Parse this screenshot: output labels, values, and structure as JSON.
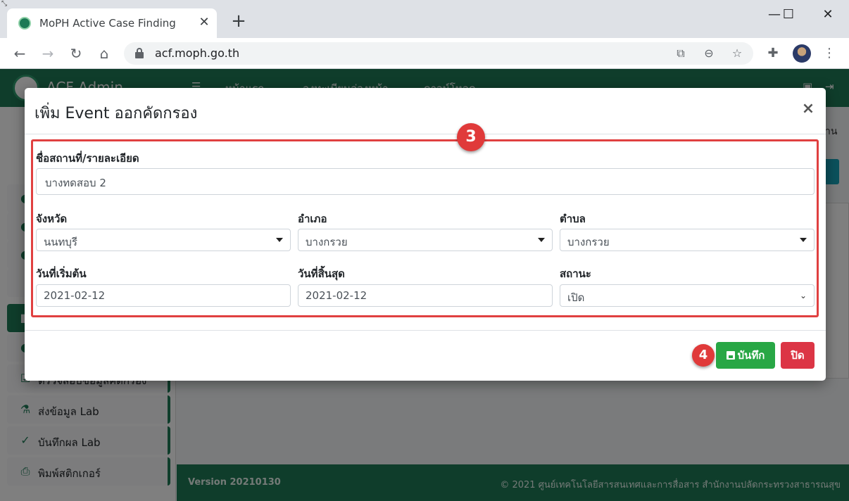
{
  "browser": {
    "tab_title": "MoPH Active Case Finding",
    "tab_close": "✕",
    "new_tab": "+",
    "url": "acf.moph.go.th",
    "window_controls": {
      "minimize": "—",
      "maximize": "☐",
      "close": "✕"
    }
  },
  "app": {
    "brand": "ACF Admin",
    "nav": [
      "หน้าแรก",
      "ลงทะเบียนล่วงหน้า",
      "ดาวน์โหลด"
    ],
    "content_text": "าน",
    "sidebar": [
      {
        "label": "",
        "icon": "user-icon"
      },
      {
        "label": "",
        "icon": "user-icon"
      },
      {
        "label": "",
        "icon": "user-icon"
      },
      {
        "label": "",
        "icon": "list-icon"
      },
      {
        "label": "",
        "icon": "event-icon",
        "active": true
      },
      {
        "label": "",
        "icon": "user-icon"
      },
      {
        "label": "ตรวจสอบข้อมูลคัดกรอง",
        "icon": "check-icon"
      },
      {
        "label": "ส่งข้อมูล Lab",
        "icon": "flask-icon"
      },
      {
        "label": "บันทึกผล Lab",
        "icon": "clipboard-icon"
      },
      {
        "label": "พิมพ์สติกเกอร์",
        "icon": "printer-icon"
      }
    ],
    "footer_left": "Version 20210130",
    "footer_right": "© 2021 ศูนย์เทคโนโลยีสารสนเทศและการสื่อสาร สำนักงานปลัดกระทรวงสาธารณสุข"
  },
  "modal": {
    "title": "เพิ่ม Event ออกคัดกรอง",
    "close": "×",
    "step_badge_1": "3",
    "step_badge_2": "4",
    "place_label": "ชื่อสถานที่/รายละเอียด",
    "place_value": "บางทดสอบ 2",
    "province_label": "จังหวัด",
    "province_value": "นนทบุรี",
    "district_label": "อำเภอ",
    "district_value": "บางกรวย",
    "subdistrict_label": "ตำบล",
    "subdistrict_value": "บางกรวย",
    "start_label": "วันที่เริ่มต้น",
    "start_value": "2021-02-12",
    "end_label": "วันที่สิ้นสุด",
    "end_value": "2021-02-12",
    "status_label": "สถานะ",
    "status_value": "เปิด",
    "save_button": "บันทึก",
    "close_button": "ปิด"
  },
  "colors": {
    "primary_green": "#1e7a57",
    "save_green": "#28a745",
    "danger_red": "#dc3545",
    "highlight_red": "#e04040"
  }
}
